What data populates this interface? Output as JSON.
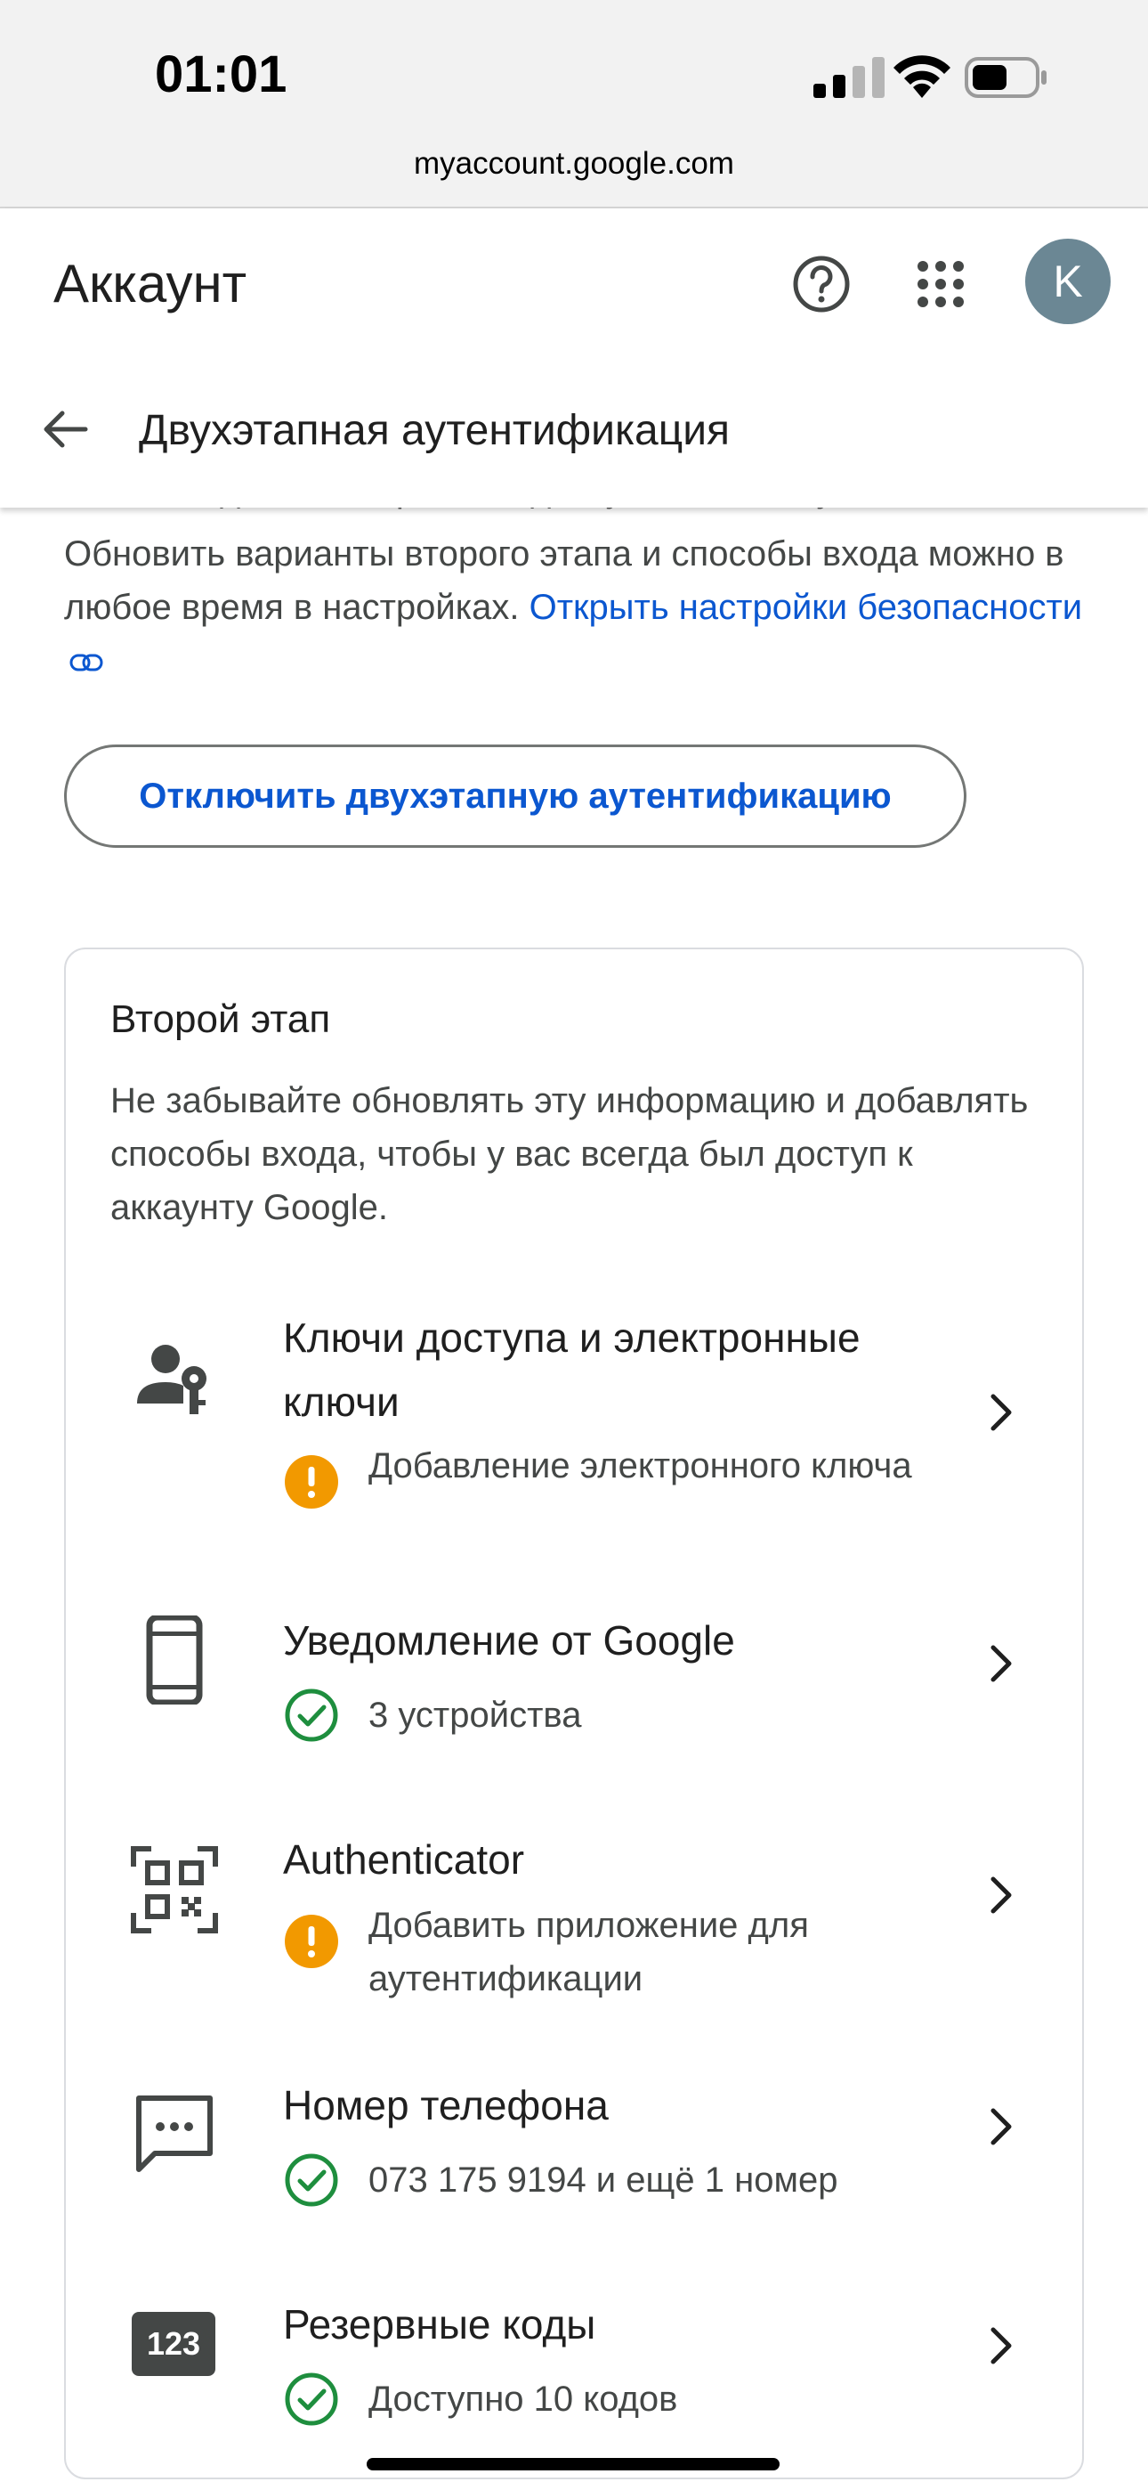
{
  "status_bar": {
    "time": "01:01",
    "url": "myaccount.google.com"
  },
  "app": {
    "title": "Аккаунт",
    "avatar_letter": "K",
    "page_title": "Двухэтапная аутентификация"
  },
  "intro": {
    "cut_text": "самом надежном варианте, доступном в аккаунте.",
    "text": "Обновить варианты второго этапа и способы входа можно в любое время в настройках.",
    "link_text": "Открыть настройки безопасности"
  },
  "disable_button": "Отключить двухэтапную аутентификацию",
  "second_step": {
    "title": "Второй этап",
    "description": "Не забывайте обновлять эту информацию и добавлять способы входа, чтобы у вас всегда был доступ к аккаунту Google.",
    "items": [
      {
        "title": "Ключи доступа и электронные ключи",
        "status": "Добавление электронного ключа",
        "status_type": "warning",
        "icon": "person-key-icon"
      },
      {
        "title": "Уведомление от Google",
        "status": "3 устройства",
        "status_type": "ok",
        "icon": "phone-icon"
      },
      {
        "title": "Authenticator",
        "status": "Добавить приложение для аутентификации",
        "status_type": "warning",
        "icon": "qr-code-icon"
      },
      {
        "title": "Номер телефона",
        "status": "073 175 9194 и ещё 1 номер",
        "status_type": "ok",
        "icon": "message-icon"
      },
      {
        "title": "Резервные коды",
        "status": "Доступно 10 кодов",
        "status_type": "ok",
        "icon": "backup-codes-icon",
        "icon_text": "123"
      }
    ]
  },
  "colors": {
    "link": "#0b57d0",
    "warning": "#f29900",
    "ok": "#1e8e3e"
  }
}
